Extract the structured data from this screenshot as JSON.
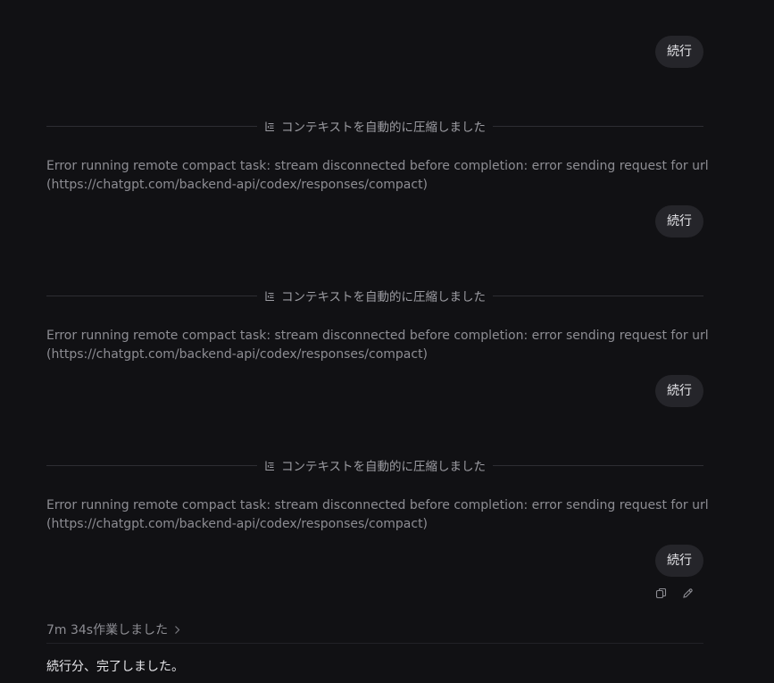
{
  "thread": {
    "user_messages": [
      "続行",
      "続行",
      "続行",
      "続行"
    ],
    "compaction_notice": "コンテキストを自動的に圧縮しました",
    "errors": [
      {
        "line1": "Error running remote compact task: stream disconnected before completion: error sending request for url",
        "line2": "(https://chatgpt.com/backend-api/codex/responses/compact)"
      },
      {
        "line1": "Error running remote compact task: stream disconnected before completion: error sending request for url",
        "line2": "(https://chatgpt.com/backend-api/codex/responses/compact)"
      },
      {
        "line1": "Error running remote compact task: stream disconnected before completion: error sending request for url",
        "line2": "(https://chatgpt.com/backend-api/codex/responses/compact)"
      }
    ],
    "message_actions": {
      "copy_icon": "copy-icon",
      "edit_icon": "pencil-icon"
    },
    "work_summary": "7m 34s作業しました",
    "final_response": "続行分、完了しました。"
  },
  "colors": {
    "background": "#111114",
    "pill_background": "#25252a",
    "muted_text": "#8d8d93",
    "primary_text": "#e6e6ea"
  }
}
